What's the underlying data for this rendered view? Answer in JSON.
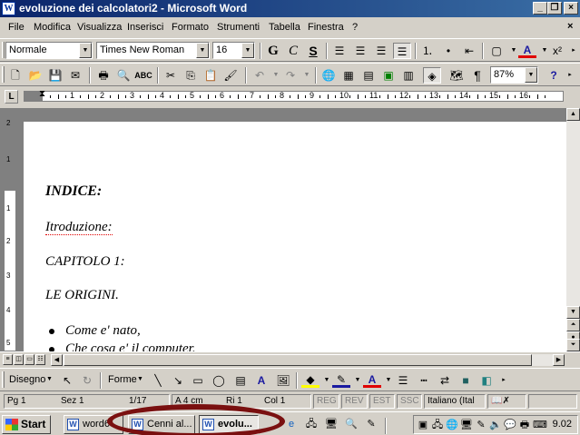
{
  "window": {
    "title": "evoluzione dei calcolatori2 - Microsoft Word",
    "app_icon": "W",
    "minimize_glyph": "_",
    "restore_glyph": "❐",
    "close_glyph": "×"
  },
  "menu": {
    "items": [
      "File",
      "Modifica",
      "Visualizza",
      "Inserisci",
      "Formato",
      "Strumenti",
      "Tabella",
      "Finestra",
      "?"
    ]
  },
  "formatting": {
    "style": "Normale",
    "font": "Times New Roman",
    "size": "16",
    "bold": "G",
    "italic": "C",
    "underline": "S",
    "font_color_letter": "A",
    "superscript": "x²"
  },
  "standard": {
    "zoom": "87%",
    "pilcrow": "¶",
    "help": "?"
  },
  "ruler": {
    "marks": [
      "1",
      "2",
      "3",
      "4",
      "5",
      "6",
      "7",
      "8",
      "9",
      "10",
      "11",
      "12",
      "13",
      "14",
      "15",
      "16"
    ],
    "tab_selector": "L"
  },
  "vertical_ruler": {
    "marks": [
      "2",
      "1",
      "1",
      "2",
      "3",
      "4",
      "5"
    ]
  },
  "document": {
    "heading": "INDICE:",
    "lines": [
      "Itroduzione:",
      "CAPITOLO 1:",
      "LE ORIGINI."
    ],
    "bullets": [
      "Come e' nato,",
      "Che cosa e' il computer."
    ]
  },
  "drawing": {
    "draw_label": "Disegno",
    "shapes_label": "Forme",
    "text_color_letter": "A"
  },
  "status": {
    "page": "Pg  1",
    "section": "Sez  1",
    "pages": "1/17",
    "at": "A 4 cm",
    "line": "Ri  1",
    "col": "Col  1",
    "rec": "REG",
    "rev": "REV",
    "ext": "EST",
    "ovr": "SSC",
    "language": "Italiano (Ital"
  },
  "taskbar": {
    "start": "Start",
    "tasks": [
      "word6",
      "Cenni al...",
      "evolu..."
    ],
    "clock": "9.02"
  },
  "colors": {
    "title_start": "#0a246a",
    "title_end": "#3a6ea5",
    "chrome": "#d4d0c8",
    "annotation": "#7a1010"
  }
}
